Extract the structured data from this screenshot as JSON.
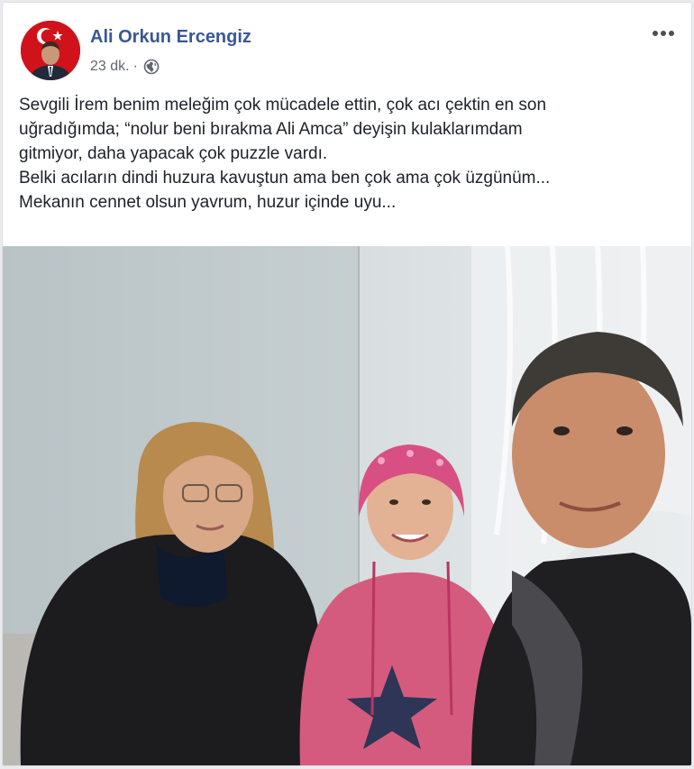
{
  "post": {
    "author": "Ali Orkun Ercengiz",
    "timestamp": "23 dk.",
    "separator": "·",
    "audience_icon": "globe-icon",
    "more_icon": "more-options-icon",
    "text_lines": [
      "Sevgili İrem benim meleğim çok mücadele ettin, çok acı çektin en son",
      "uğradığımda; “nolur beni bırakma Ali Amca” deyişin kulaklarımdam",
      "gitmiyor, daha yapacak çok puzzle vardı.",
      "Belki acıların dindi huzura kavuştun ama ben çok ama çok üzgünüm...",
      "Mekanın cennet olsun yavrum, huzur içinde uyu..."
    ]
  },
  "colors": {
    "author_link": "#385898",
    "secondary_text": "#606770",
    "body_text": "#1d2129",
    "avatar_bg": "#d0121b"
  }
}
